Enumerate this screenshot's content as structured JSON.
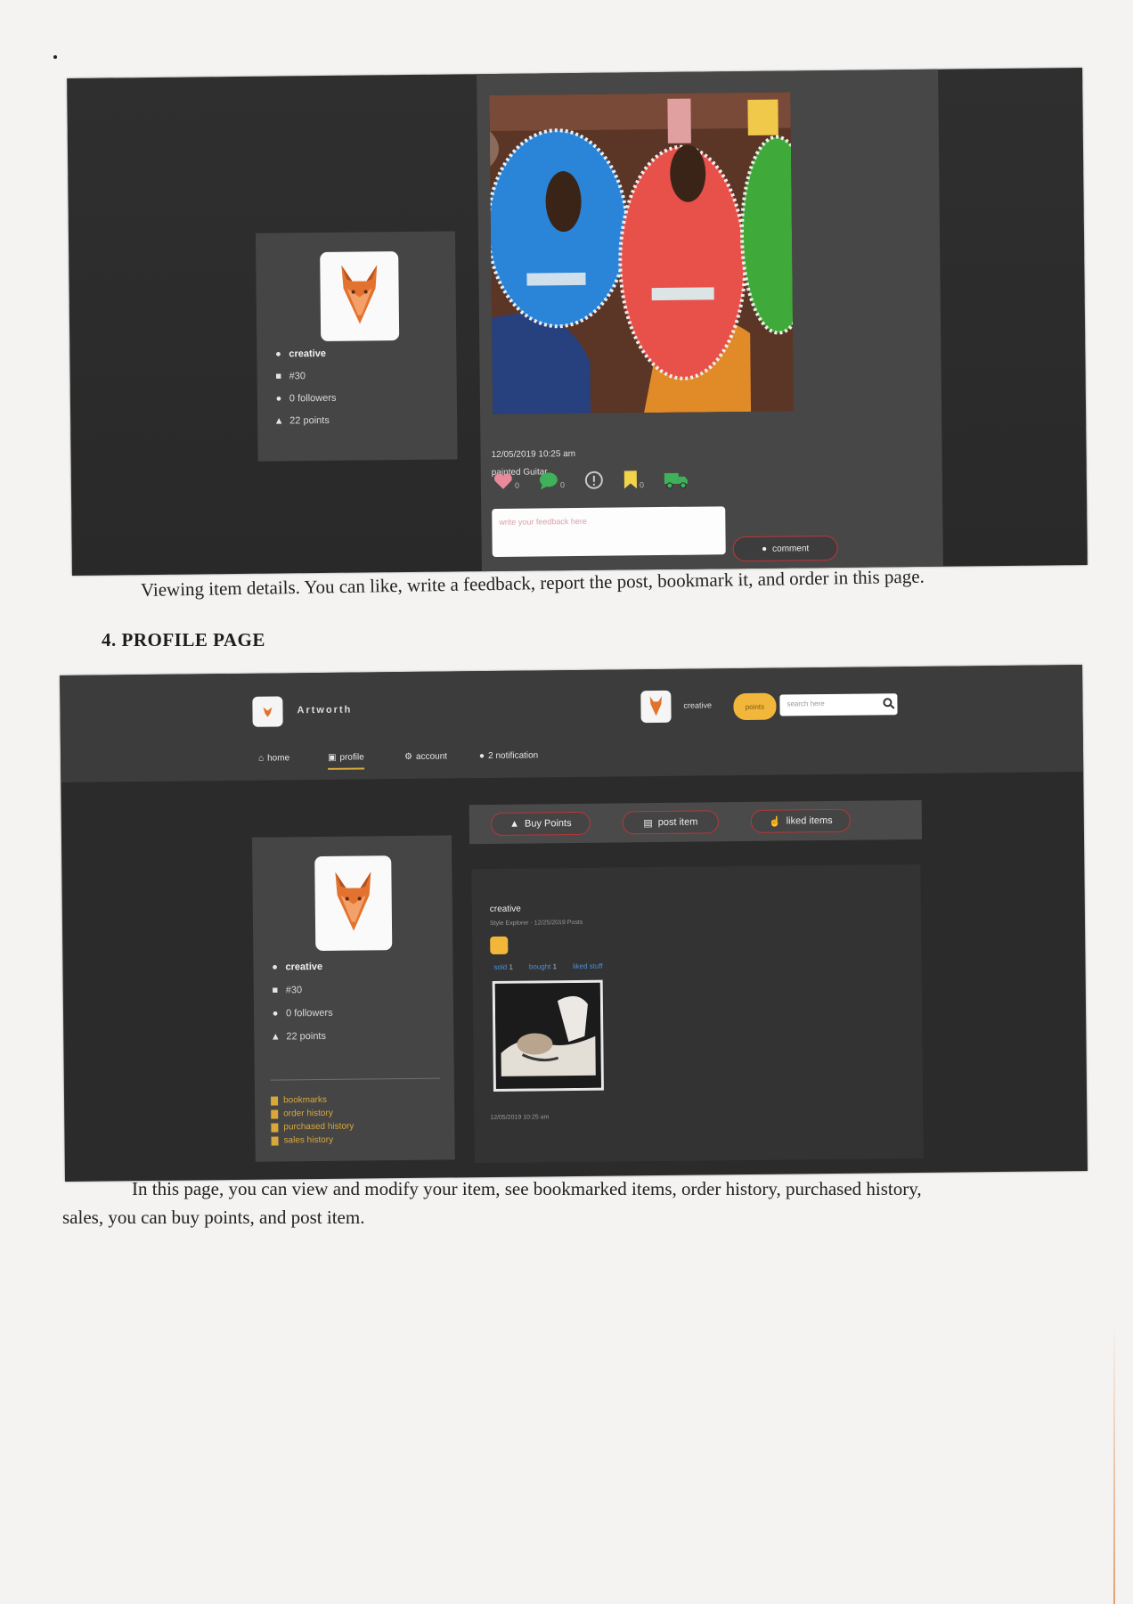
{
  "shot1": {
    "profile": {
      "name": "creative",
      "stat2": "#30",
      "followers": "0 followers",
      "points": "22 points"
    },
    "post": {
      "timestamp": "12/05/2019 10:25 am",
      "title": "painted Guitar",
      "like_count": "0",
      "comment_count": "0",
      "bookmark_count": "0",
      "feedback_placeholder": "write your feedback here",
      "comment_button": "comment"
    }
  },
  "caption1": "Viewing item details. You can like, write a feedback, report the post, bookmark it, and order in this page.",
  "section_heading": "4.   PROFILE PAGE",
  "shot2": {
    "brand": "Artworth",
    "user_name": "creative",
    "points_pill": "points",
    "search_placeholder": "search here",
    "nav": {
      "home": "home",
      "profile": "profile",
      "account": "account",
      "notification": "2 notification"
    },
    "buttons": {
      "buy_points": "Buy Points",
      "post_item": "post item",
      "liked_items": "liked items"
    },
    "profile": {
      "name": "creative",
      "stat2": "#30",
      "followers": "0 followers",
      "points": "22 points",
      "links": [
        "bookmarks",
        "order history",
        "purchased history",
        "sales history"
      ]
    },
    "content": {
      "name": "creative",
      "subtitle": "Style Explorer · 12/25/2019 Posts",
      "tabs": [
        {
          "label": "sold",
          "count": "1"
        },
        {
          "label": "bought",
          "count": "1"
        },
        {
          "label": "liked stuff",
          "count": ""
        }
      ],
      "date": "12/05/2019 10:25 am"
    }
  },
  "caption2_line1": "In this page, you can view and modify your item, see bookmarked items, order history, purchased history,",
  "caption2_line2": "sales, you can buy points, and post item.",
  "colors": {
    "panel": "#474747",
    "accent_yellow": "#f2b63a",
    "button_border": "#b8363a",
    "link_yellow": "#d9a83a"
  }
}
